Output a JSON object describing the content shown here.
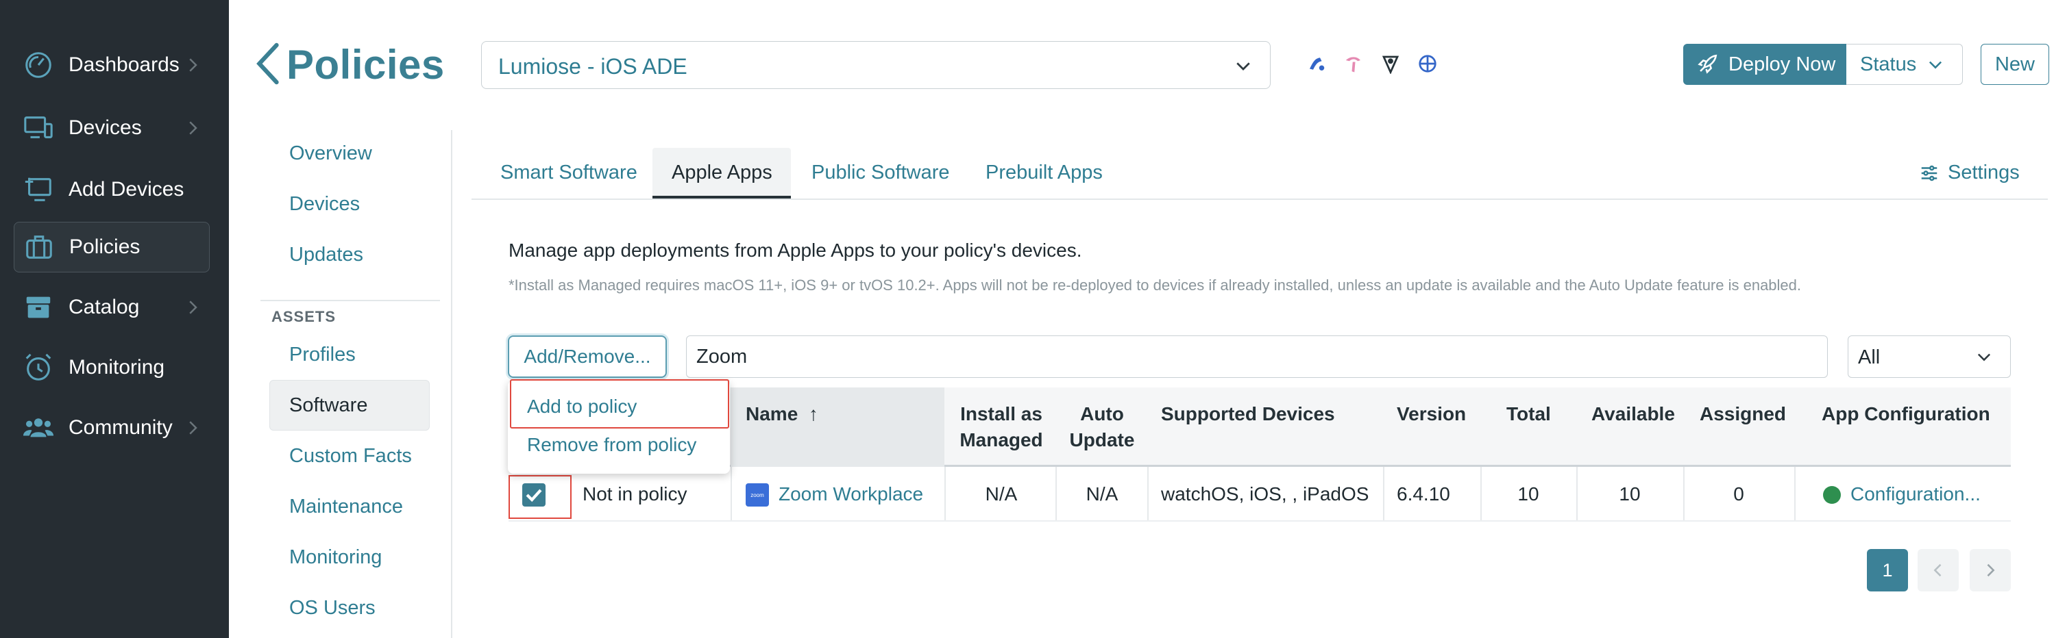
{
  "sidebar": {
    "items": [
      {
        "label": "Dashboards",
        "icon": "gauge-icon",
        "has_chevron": true
      },
      {
        "label": "Devices",
        "icon": "devices-icon",
        "has_chevron": true
      },
      {
        "label": "Add Devices",
        "icon": "add-device-icon",
        "has_chevron": false
      },
      {
        "label": "Policies",
        "icon": "briefcase-icon",
        "has_chevron": false,
        "active": true
      },
      {
        "label": "Catalog",
        "icon": "archive-box-icon",
        "has_chevron": true
      },
      {
        "label": "Monitoring",
        "icon": "alarm-clock-icon",
        "has_chevron": false
      },
      {
        "label": "Community",
        "icon": "people-icon",
        "has_chevron": true
      }
    ]
  },
  "header": {
    "title": "Policies",
    "policy_select": "Lumiose - iOS ADE",
    "os_icons": [
      "macos-icon",
      "tvos-icon",
      "visionos-icon",
      "ios-icon"
    ],
    "deploy_label": "Deploy Now",
    "status_label": "Status",
    "new_label": "New"
  },
  "subnav": {
    "top_items": [
      "Overview",
      "Devices",
      "Updates"
    ],
    "assets_heading": "ASSETS",
    "asset_items": [
      "Profiles",
      "Software",
      "Custom Facts",
      "Maintenance",
      "Monitoring",
      "OS Users"
    ],
    "active": "Software"
  },
  "tabs": {
    "items": [
      "Smart Software",
      "Apple Apps",
      "Public Software",
      "Prebuilt Apps"
    ],
    "active": "Apple Apps",
    "settings_label": "Settings"
  },
  "content": {
    "intro": "Manage app deployments from Apple Apps to your policy's devices.",
    "note": "*Install as Managed requires macOS 11+, iOS 9+ or tvOS 10.2+. Apps will not be re-deployed to devices if already installed, unless an update is available and the Auto Update feature is enabled.",
    "add_remove_label": "Add/Remove...",
    "search_value": "Zoom",
    "filter_value": "All"
  },
  "dropdown": {
    "add_label": "Add to policy",
    "remove_label": "Remove from policy"
  },
  "table": {
    "columns": {
      "name": "Name",
      "sort_arrow": "↑",
      "install_as_managed": [
        "Install as",
        "Managed"
      ],
      "auto_update": [
        "Auto",
        "Update"
      ],
      "supported_devices": "Supported Devices",
      "version": "Version",
      "total": "Total",
      "available": "Available",
      "assigned": "Assigned",
      "app_configuration": "App Configuration"
    },
    "rows": [
      {
        "checked": true,
        "status": "Not in policy",
        "icon_text": "zoom",
        "name": "Zoom Workplace",
        "install_as_managed": "N/A",
        "auto_update": "N/A",
        "supported_devices": "watchOS, iOS, , iPadOS",
        "version": "6.4.10",
        "total": "10",
        "available": "10",
        "assigned": "0",
        "app_configuration": "Configuration..."
      }
    ]
  },
  "pagination": {
    "current_page": "1"
  },
  "colors": {
    "sidebar_bg": "#262d33",
    "accent": "#3c8197",
    "link": "#2f7d92",
    "highlight_red": "#e0483e",
    "status_green": "#2e8f4f"
  }
}
